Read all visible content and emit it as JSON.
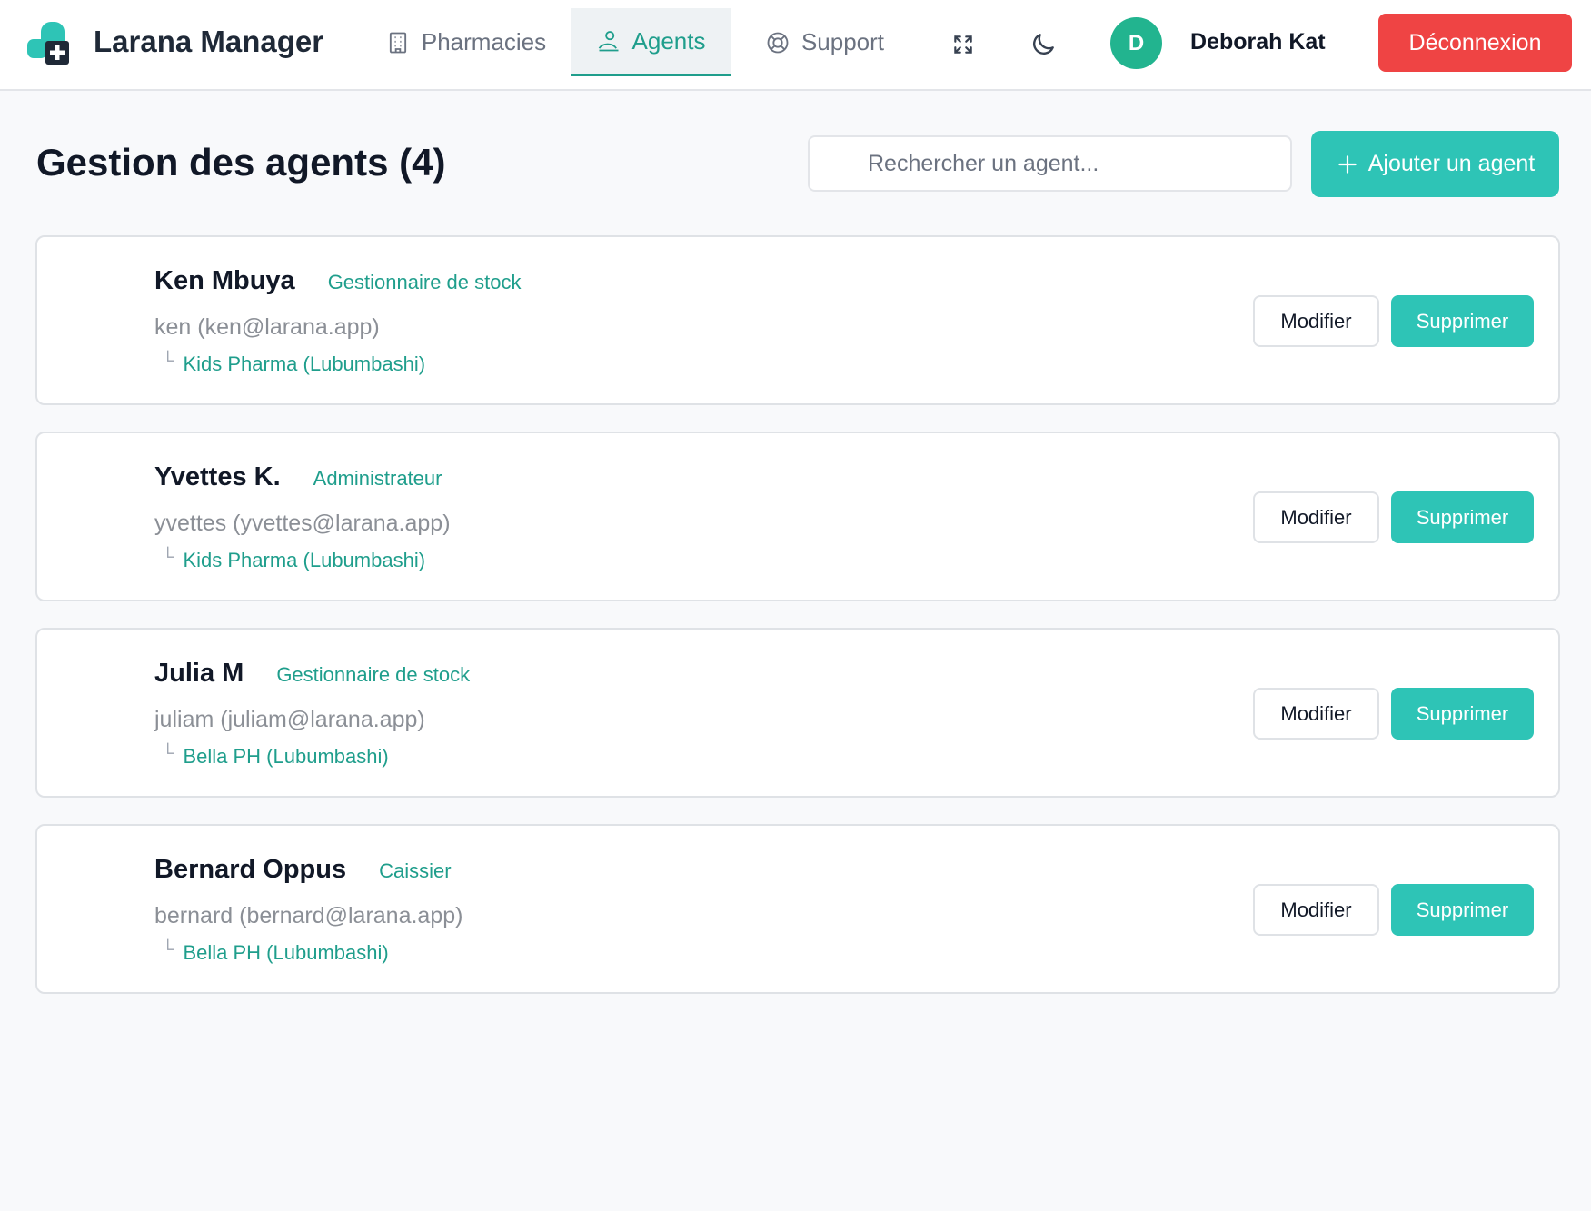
{
  "app": {
    "title": "Larana Manager",
    "logo_icon": "pharmacy-cross-logo"
  },
  "nav": {
    "items": [
      {
        "label": "Pharmacies",
        "icon": "building-icon",
        "active": false
      },
      {
        "label": "Agents",
        "icon": "user-gear-icon",
        "active": true
      },
      {
        "label": "Support",
        "icon": "lifebuoy-icon",
        "active": false
      }
    ],
    "fullscreen_icon": "expand-icon",
    "theme_icon": "moon-icon"
  },
  "user": {
    "initial": "D",
    "name": "Deborah Kat",
    "logout_label": "Déconnexion"
  },
  "page": {
    "title": "Gestion des agents (4)",
    "search_placeholder": "Rechercher un agent...",
    "add_label": "Ajouter un agent"
  },
  "agents": [
    {
      "name": "Ken Mbuya",
      "role": "Gestionnaire de stock",
      "login": "ken (ken@larana.app)",
      "pharmacy": "Kids Pharma (Lubumbashi)",
      "edit_label": "Modifier",
      "delete_label": "Supprimer"
    },
    {
      "name": "Yvettes K.",
      "role": "Administrateur",
      "login": "yvettes (yvettes@larana.app)",
      "pharmacy": "Kids Pharma (Lubumbashi)",
      "edit_label": "Modifier",
      "delete_label": "Supprimer"
    },
    {
      "name": "Julia M",
      "role": "Gestionnaire de stock",
      "login": "juliam (juliam@larana.app)",
      "pharmacy": "Bella PH (Lubumbashi)",
      "edit_label": "Modifier",
      "delete_label": "Supprimer"
    },
    {
      "name": "Bernard Oppus",
      "role": "Caissier",
      "login": "bernard (bernard@larana.app)",
      "pharmacy": "Bella PH (Lubumbashi)",
      "edit_label": "Modifier",
      "delete_label": "Supprimer"
    }
  ],
  "colors": {
    "accent": "#2ec4b6",
    "accent_text": "#1f9e8c",
    "danger": "#ef4444",
    "avatar": "#22b48f",
    "background": "#f8f9fb"
  }
}
